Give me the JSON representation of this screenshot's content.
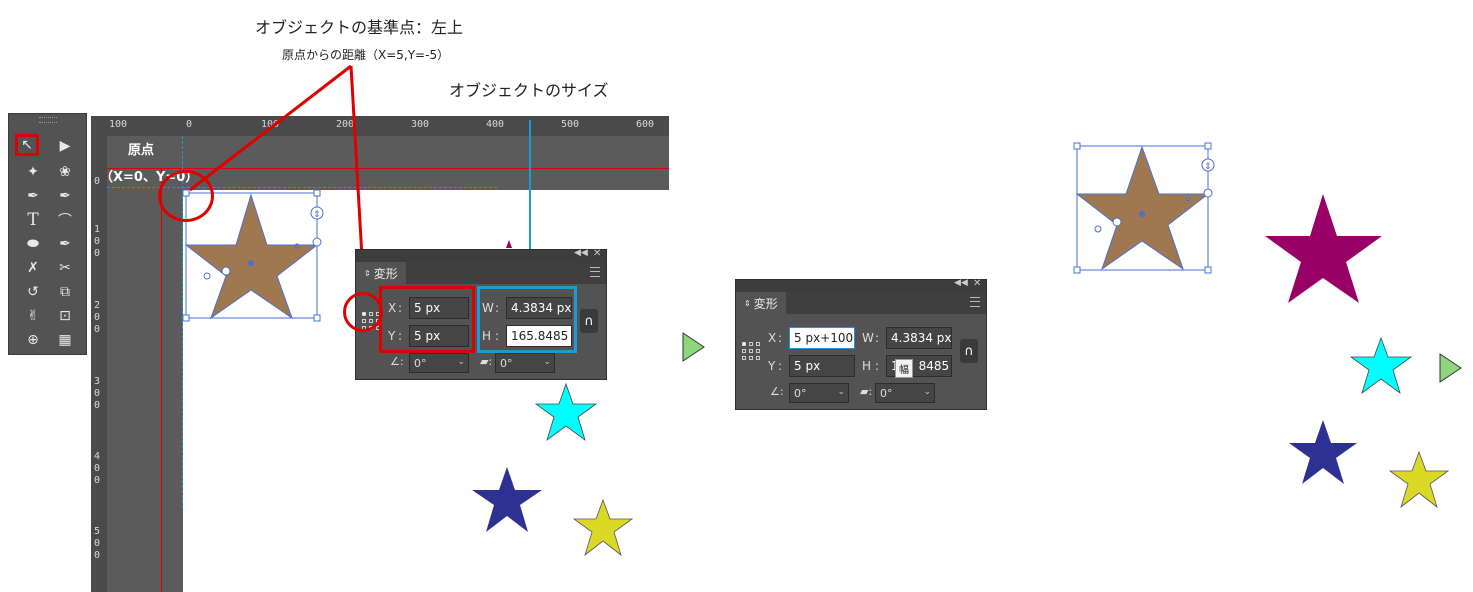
{
  "annotations": {
    "reference_point": "オブジェクトの基準点：左上",
    "distance_from_origin": "原点からの距離（X=5,Y=-5）",
    "object_size": "オブジェクトのサイズ"
  },
  "canvas": {
    "origin_label": "原点",
    "origin_coords": "（X=0、Y=0）",
    "ruler_top_ticks": [
      "100",
      "0",
      "100",
      "200",
      "300",
      "400",
      "500",
      "600"
    ],
    "ruler_left_ticks": [
      "0",
      "1\n0\n0",
      "2\n0\n0",
      "3\n0\n0",
      "4\n0\n0",
      "5\n0\n0"
    ]
  },
  "transform_panel_before": {
    "tab": "変形",
    "x_label": "X",
    "y_label": "Y",
    "w_label": "W",
    "h_label": "H",
    "x_value": "5 px",
    "y_value": "5 px",
    "w_value": "4.3834 px",
    "h_value": "165.8485",
    "rotate_value": "0°",
    "shear_value": "0°"
  },
  "transform_panel_after": {
    "tab": "変形",
    "x_label": "X",
    "y_label": "Y",
    "w_label": "W",
    "h_label": "H",
    "x_value": "5 px+100",
    "y_value": "5 px",
    "w_value": "4.3834 px",
    "h_value": "8485",
    "h_prefix": "1",
    "tooltip": "幅",
    "rotate_value": "0°",
    "shear_value": "0°"
  },
  "colors": {
    "star_brown": "#a0784f",
    "star_magenta": "#990066",
    "star_cyan": "#00ffff",
    "star_navy": "#2e3192",
    "star_yellow": "#d9d926",
    "arrow_green": "#8ed67e",
    "highlight_red": "#e00000",
    "highlight_blue": "#1a9ad6",
    "selection_blue": "#4a6fd6"
  },
  "icons": [
    "selection-tool-icon",
    "direct-selection-tool-icon",
    "magic-wand-icon",
    "lasso-icon",
    "pen-icon",
    "curvature-pen-icon",
    "type-icon",
    "line-segment-icon",
    "ellipse-icon",
    "paintbrush-icon",
    "shaper-icon",
    "scissors-icon",
    "rotate-icon",
    "scale-icon",
    "warp-icon",
    "free-transform-icon",
    "shape-builder-icon",
    "perspective-grid-icon",
    "link-icon",
    "menu-icon",
    "reference-point-grid-icon"
  ]
}
